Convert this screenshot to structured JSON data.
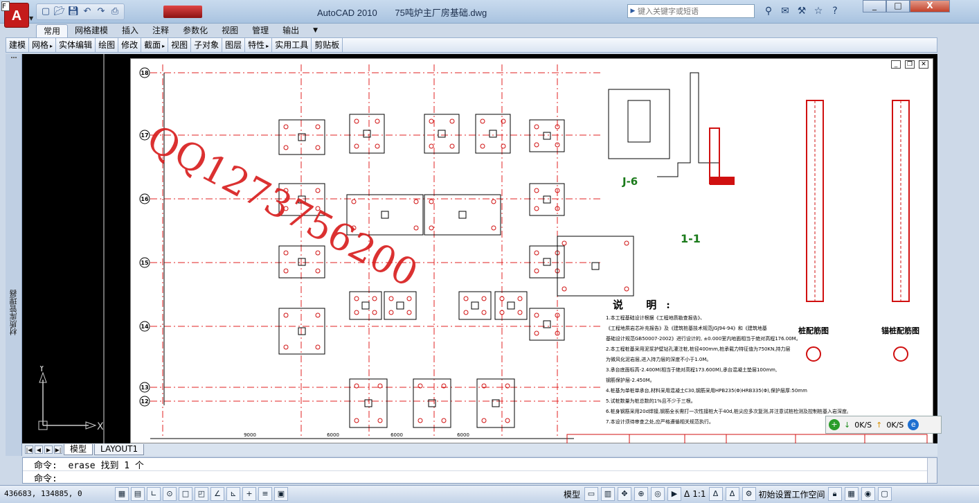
{
  "window": {
    "app_title": "AutoCAD 2010",
    "doc_title": "75吨炉主厂房基础.dwg",
    "search_placeholder": "键入关键字或短语",
    "minimize": "_",
    "maximize": "□",
    "close": "X"
  },
  "quick_access": [
    "new-icon",
    "open-icon",
    "save-icon",
    "undo-icon",
    "redo-icon",
    "plot-icon"
  ],
  "ribbon_tabs": [
    "常用",
    "网格建模",
    "插入",
    "注释",
    "参数化",
    "视图",
    "管理",
    "输出"
  ],
  "panels": [
    "建模",
    "网格",
    "实体编辑",
    "绘图",
    "修改",
    "截面",
    "视图",
    "子对象",
    "图层",
    "特性",
    "实用工具",
    "剪贴板"
  ],
  "left_palette_label": "材质库管理器",
  "watermark": "QQ1273756200",
  "drawing": {
    "grid_axes": [
      "18",
      "17",
      "16",
      "15",
      "14",
      "13",
      "12"
    ],
    "axis_dims": [
      "9000",
      "6000",
      "6000",
      "6000"
    ],
    "notes_title": "说 明:",
    "notes": [
      "1.本工程基础设计根据《工程地质勘查报告》、",
      "《工程地质岩芯补充报告》及《建筑桩基技术规范JGJ94-94》和《建筑地基",
      "基础设计规范GB50007-2002》进行设计的, ±0.000室内地面相当于绝对高程176.00M。",
      "2.本工程桩基采用泥浆护壁钻孔灌注桩,桩径400mm,桩承载力特征值为750KN,持力层",
      "为微风化泥岩层,进入持力层的深度不小于1.0M。",
      "3.承台底面标高-2.400M(相当于绝对高程173.600M),承台混凝土垫层100mm,",
      "钢筋保护层-2.450M。",
      "4.桩基为单桩单承台,材料采用混凝土C30,钢筋采用HPB235(Φ)HRB335(Φ),保护层厚:50mm",
      "5.试桩数量为桩总数的1%且不少于三根。",
      "6.桩身钢筋采用20d焊接,钢筋全长需打一次性接桩大于40d,桩尖应多次复测,并注意试桩检测及控制桩基入岩深度。",
      "7.本设计须待审查之处,应严格遵循相关规范执行。"
    ],
    "pile_label_1": "桩配筋图",
    "pile_label_2": "锚桩配筋图",
    "section_label": "1-1",
    "detail_label": "J-6"
  },
  "speed_widget": {
    "down": "0K/S",
    "up": "0K/S"
  },
  "layout_tabs": [
    "模型",
    "LAYOUT1"
  ],
  "command_line": {
    "history": "命令:  erase 找到 1 个",
    "prompt": "命令:"
  },
  "status": {
    "coords": "436683, 134885, 0",
    "model_label": "模型",
    "scale": "1:1",
    "workspace": "初始设置工作空间"
  }
}
